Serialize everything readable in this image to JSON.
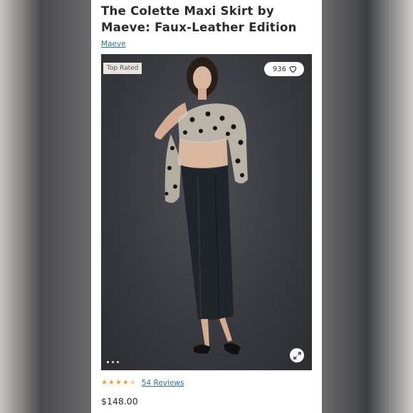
{
  "product": {
    "title": "The Colette Maxi Skirt by Maeve: Faux-Leather Edition",
    "brand": "Maeve",
    "badge": "Top Rated",
    "likes": "936",
    "rating": 4.5,
    "reviews_label": "54 Reviews",
    "price": "$148.00"
  },
  "gallery": {
    "image_count": 3,
    "active_index": 0
  },
  "icons": {
    "like": "heart-icon",
    "expand": "expand-icon",
    "rating": "star-icon"
  },
  "colors": {
    "link": "#2a6fa8",
    "star": "#d6a93a",
    "badge_bg": "#e9e5de"
  }
}
